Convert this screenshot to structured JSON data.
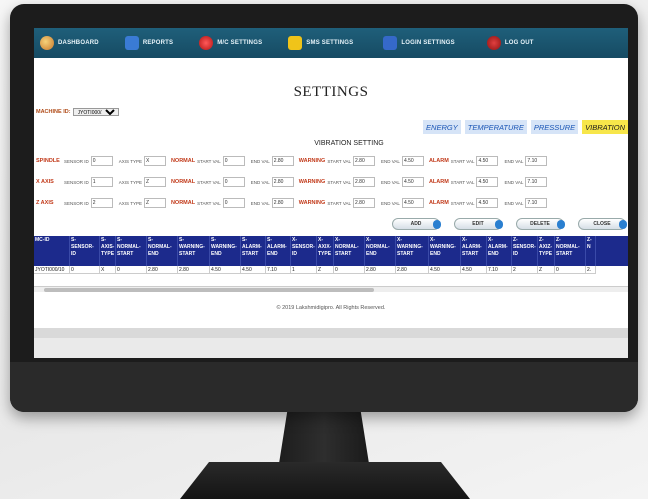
{
  "nav": {
    "items": [
      {
        "label": "DASHBOARD",
        "icon": "dashboard-icon"
      },
      {
        "label": "REPORTS",
        "icon": "reports-icon"
      },
      {
        "label": "M/C SETTINGS",
        "icon": "machine-settings-icon"
      },
      {
        "label": "SMS SETTINGS",
        "icon": "sms-icon"
      },
      {
        "label": "LOGIN SETTINGS",
        "icon": "login-settings-icon"
      },
      {
        "label": "LOG OUT",
        "icon": "logout-icon"
      }
    ]
  },
  "page": {
    "title": "SETTINGS"
  },
  "machine": {
    "label": "MACHINE ID:",
    "selected": "JYOTI000/1"
  },
  "category_tabs": [
    {
      "label": "ENERGY",
      "active": false
    },
    {
      "label": "TEMPERATURE",
      "active": false
    },
    {
      "label": "PRESSURE",
      "active": false
    },
    {
      "label": "VIBRATION",
      "active": true
    }
  ],
  "section_title": "VIBRATION SETTING",
  "field_labels": {
    "sensor_id": "SENSOR ID",
    "axis_type": "AXIS TYPE",
    "normal": "NORMAL",
    "warning": "WARNING",
    "alarm": "ALARM",
    "start_val": "START VAL",
    "end_val": "END VAL"
  },
  "rows": [
    {
      "label": "SPINDLE",
      "sensor_id": "0",
      "axis_type": "X",
      "normal_start": "0",
      "normal_end": "2.80",
      "warning_start": "2.80",
      "warning_end": "4.50",
      "alarm_start": "4.50",
      "alarm_end": "7.10"
    },
    {
      "label": "X AXIS",
      "sensor_id": "1",
      "axis_type": "Z",
      "normal_start": "0",
      "normal_end": "2.80",
      "warning_start": "2.80",
      "warning_end": "4.50",
      "alarm_start": "4.50",
      "alarm_end": "7.10"
    },
    {
      "label": "Z AXIS",
      "sensor_id": "2",
      "axis_type": "Z",
      "normal_start": "0",
      "normal_end": "2.80",
      "warning_start": "2.80",
      "warning_end": "4.50",
      "alarm_start": "4.50",
      "alarm_end": "7.10"
    }
  ],
  "buttons": {
    "add": "ADD",
    "edit": "EDIT",
    "delete": "DELETE",
    "close": "CLOSE"
  },
  "table": {
    "headers": [
      "MC-ID",
      "S-SENSOR-ID",
      "S-AXIS-TYPE",
      "S-NORMAL-START",
      "S-NORMAL-END",
      "S-WARNING-START",
      "S-WARNING-END",
      "S-ALARM-START",
      "S-ALARM-END",
      "X-SENSOR-ID",
      "X-AXIX-TYPE",
      "X-NORMAL-START",
      "X-NORMAL-END",
      "X-WARNING-START",
      "X-WARNING-END",
      "X-ALARM-START",
      "X-ALARM-END",
      "Z-SENSOR-ID",
      "Z-AXIZ-TYPE",
      "Z-NORMAL-START",
      "Z-N"
    ],
    "row": [
      "JYOTI000/10",
      "0",
      "X",
      "0",
      "2.80",
      "2.80",
      "4.50",
      "4.50",
      "7.10",
      "1",
      "Z",
      "0",
      "2.80",
      "2.80",
      "4.50",
      "4.50",
      "7.10",
      "2",
      "Z",
      "0",
      "2."
    ]
  },
  "footer": "© 2019 Lakshmidigipro. All Rights Reserved."
}
